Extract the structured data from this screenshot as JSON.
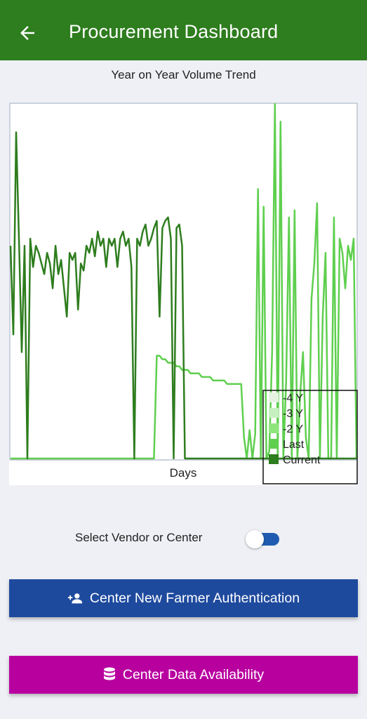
{
  "header": {
    "title": "Procurement Dashboard",
    "back_icon": "arrow-left-icon",
    "color": "#2e7d1e"
  },
  "chart_data": {
    "type": "line",
    "title": "Year on Year Volume Trend",
    "xlabel": "Days",
    "ylabel": "",
    "legend_position": "bottom-right",
    "series": [
      {
        "name": "-4 Y",
        "color": "#e6f2e2",
        "values": []
      },
      {
        "name": "-3 Y",
        "color": "#c6f0c0",
        "values": []
      },
      {
        "name": "-2 Y",
        "color": "#8ee57c",
        "values": []
      },
      {
        "name": "Last",
        "color": "#5fcf4f",
        "values": [
          0,
          0,
          0,
          0,
          0,
          0,
          0,
          0,
          0,
          0,
          0,
          0,
          0,
          0,
          0,
          0,
          0,
          0,
          0,
          0,
          0,
          0,
          0,
          0,
          0,
          0,
          0,
          0,
          0,
          0,
          0,
          0,
          0,
          0,
          0,
          0,
          0,
          0,
          0,
          0,
          0,
          0,
          0,
          0,
          0,
          0,
          0,
          0,
          0,
          0,
          0,
          0,
          29,
          29,
          28,
          28,
          27,
          27,
          27,
          26,
          26,
          25,
          25,
          25,
          24,
          24,
          24,
          24,
          23,
          23,
          23,
          23,
          22,
          22,
          22,
          22,
          22,
          21,
          21,
          21,
          21,
          21,
          21,
          6,
          0,
          8,
          0,
          7,
          76,
          0,
          71,
          0,
          2,
          30,
          100,
          0,
          95,
          0,
          22,
          68,
          0,
          70,
          0,
          18,
          30,
          6,
          0,
          45,
          55,
          72,
          0,
          40,
          58,
          0,
          0,
          68,
          0,
          62,
          58,
          48,
          60,
          56,
          62,
          0
        ]
      },
      {
        "name": "Current",
        "color": "#2e7d1e",
        "values": [
          60,
          35,
          92,
          62,
          30,
          60,
          0,
          62,
          54,
          60,
          58,
          55,
          52,
          58,
          55,
          48,
          60,
          52,
          56,
          48,
          40,
          58,
          56,
          58,
          42,
          55,
          53,
          60,
          58,
          62,
          57,
          64,
          60,
          62,
          54,
          62,
          60,
          62,
          54,
          62,
          64,
          60,
          62,
          54,
          0,
          62,
          60,
          64,
          66,
          60,
          62,
          65,
          67,
          40,
          65,
          67,
          68,
          62,
          0,
          65,
          66,
          60,
          0,
          0,
          0,
          0,
          0,
          0,
          0,
          0,
          0,
          0,
          0,
          0,
          0,
          0,
          0,
          0,
          0,
          0,
          0,
          0,
          0,
          0,
          0,
          0,
          0,
          0,
          0,
          0,
          0,
          0,
          0,
          0,
          0,
          0,
          0,
          0,
          0,
          0,
          0,
          0,
          0,
          0,
          0,
          0,
          0,
          0,
          0,
          0,
          0,
          0,
          0,
          0,
          0,
          0,
          0,
          0,
          0,
          0,
          0,
          0,
          0,
          0
        ]
      }
    ],
    "grid": false
  },
  "toggle": {
    "label": "Select Vendor or Center",
    "state": "on",
    "accent": "#1f5cb1"
  },
  "buttons": {
    "auth": {
      "label": "Center New Farmer Authentication",
      "icon": "person-add-icon",
      "color": "#1e4a9e"
    },
    "data": {
      "label": "Center Data Availability",
      "icon": "database-icon",
      "color": "#b8009f"
    }
  }
}
